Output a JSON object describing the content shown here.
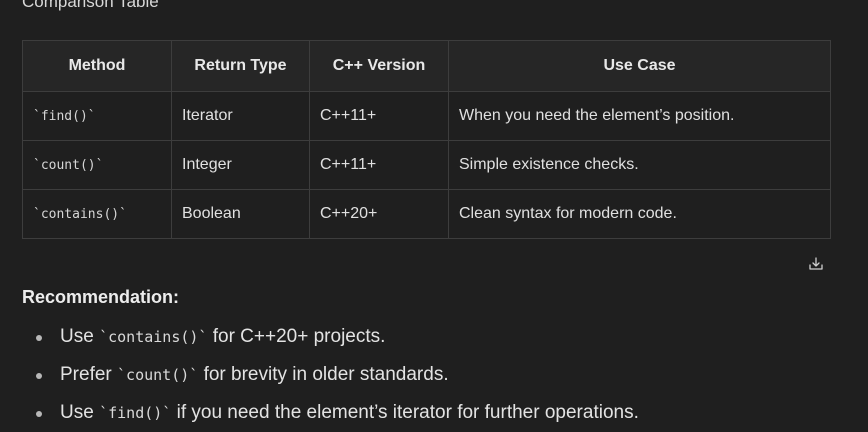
{
  "section_title": "Comparison Table",
  "table": {
    "headers": [
      "Method",
      "Return Type",
      "C++ Version",
      "Use Case"
    ],
    "rows": [
      [
        "`find()`",
        "Iterator",
        "C++11+",
        "When you need the element’s position."
      ],
      [
        "`count()`",
        "Integer",
        "C++11+",
        "Simple existence checks."
      ],
      [
        "`contains()`",
        "Boolean",
        "C++20+",
        "Clean syntax for modern code."
      ]
    ]
  },
  "download_icon": "download-icon",
  "recommendation": {
    "title": "Recommendation:",
    "items": [
      {
        "pre": "Use ",
        "code": "`contains()`",
        "post": " for C++20+ projects."
      },
      {
        "pre": "Prefer ",
        "code": "`count()`",
        "post": " for brevity in older standards."
      },
      {
        "pre": "Use ",
        "code": "`find()`",
        "post": " if you need the element’s iterator for further operations."
      }
    ]
  },
  "colors": {
    "background": "#1f1f1f",
    "border": "#3d3d3d",
    "header_bg": "#262626",
    "text": "#e3e3e3"
  }
}
